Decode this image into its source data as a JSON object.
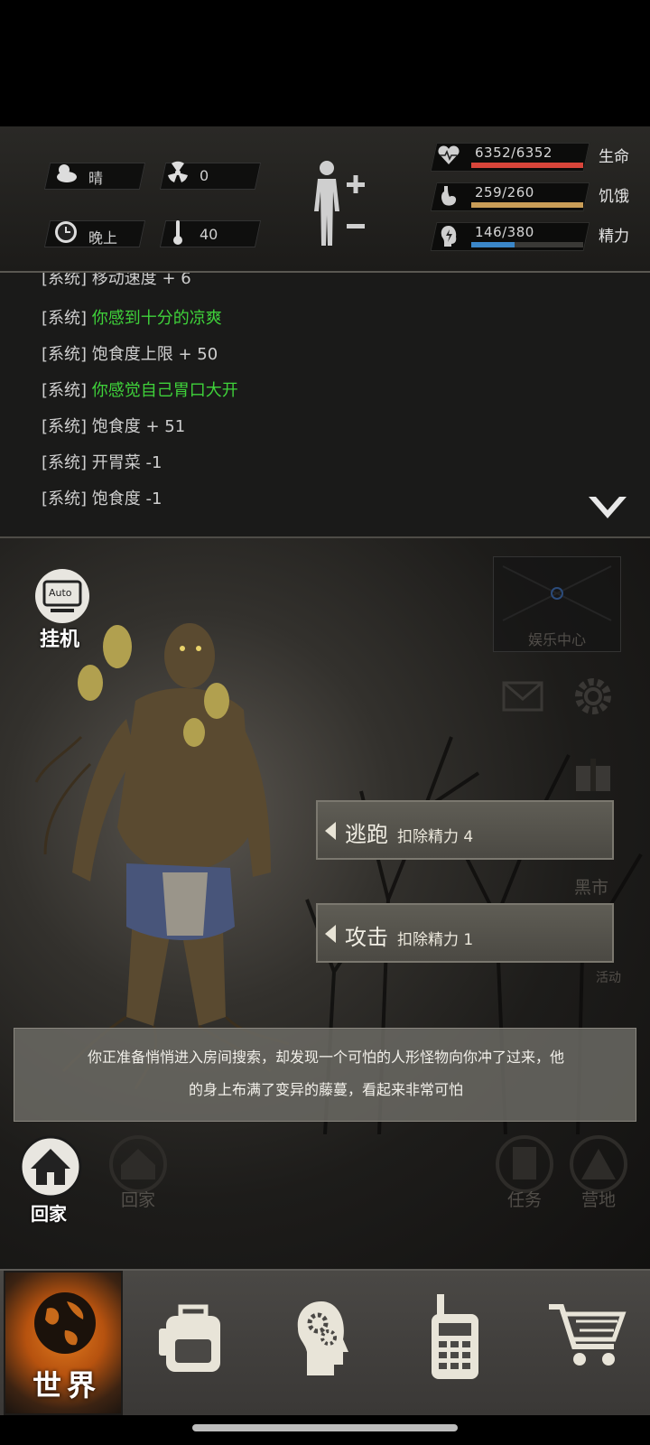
{
  "status": {
    "weather": "晴",
    "radiation": "0",
    "time_of_day": "晚上",
    "temperature": "40"
  },
  "stats": [
    {
      "icon": "heart-icon",
      "value": "6352/6352",
      "label": "生命",
      "fill": 1.0,
      "color": "#d8453a"
    },
    {
      "icon": "stomach-icon",
      "value": "259/260",
      "label": "饥饿",
      "fill": 0.996,
      "color": "#c99d57"
    },
    {
      "icon": "brain-energy-icon",
      "value": "146/380",
      "label": "精力",
      "fill": 0.384,
      "color": "#3b87c9"
    }
  ],
  "log": [
    {
      "tag": "[系统]",
      "text": "移动速度 + 6",
      "green": false
    },
    {
      "tag": "[系统]",
      "text": "你感到十分的凉爽",
      "green": true
    },
    {
      "tag": "[系统]",
      "text": "饱食度上限 + 50",
      "green": false
    },
    {
      "tag": "[系统]",
      "text": "你感觉自己胃口大开",
      "green": true
    },
    {
      "tag": "[系统]",
      "text": "饱食度 + 51",
      "green": false
    },
    {
      "tag": "[系统]",
      "text": "开胃菜 -1",
      "green": false
    },
    {
      "tag": "[系统]",
      "text": "饱食度 -1",
      "green": false
    }
  ],
  "auto": {
    "badge": "Auto",
    "label": "挂机"
  },
  "bg_labels": {
    "entertainment": "娱乐中心",
    "black_market": "黑市",
    "event": "活动",
    "home_faint": "回家",
    "task": "任务",
    "camp": "营地"
  },
  "actions": [
    {
      "label": "逃跑",
      "cost": "扣除精力 4"
    },
    {
      "label": "攻击",
      "cost": "扣除精力 1"
    }
  ],
  "story": {
    "line1": "你正准备悄悄进入房间搜索，却发现一个可怕的人形怪物向你冲了过来，他",
    "line2": "的身上布满了变异的藤蔓，看起来非常可怕"
  },
  "home_button": "回家",
  "nav": [
    {
      "name": "world",
      "label": "世界",
      "icon": "globe-icon",
      "active": true
    },
    {
      "name": "backpack",
      "label": "",
      "icon": "backpack-icon",
      "active": false
    },
    {
      "name": "skills",
      "label": "",
      "icon": "head-gears-icon",
      "active": false
    },
    {
      "name": "radio",
      "label": "",
      "icon": "walkie-talkie-icon",
      "active": false
    },
    {
      "name": "shop",
      "label": "",
      "icon": "cart-icon",
      "active": false
    }
  ]
}
